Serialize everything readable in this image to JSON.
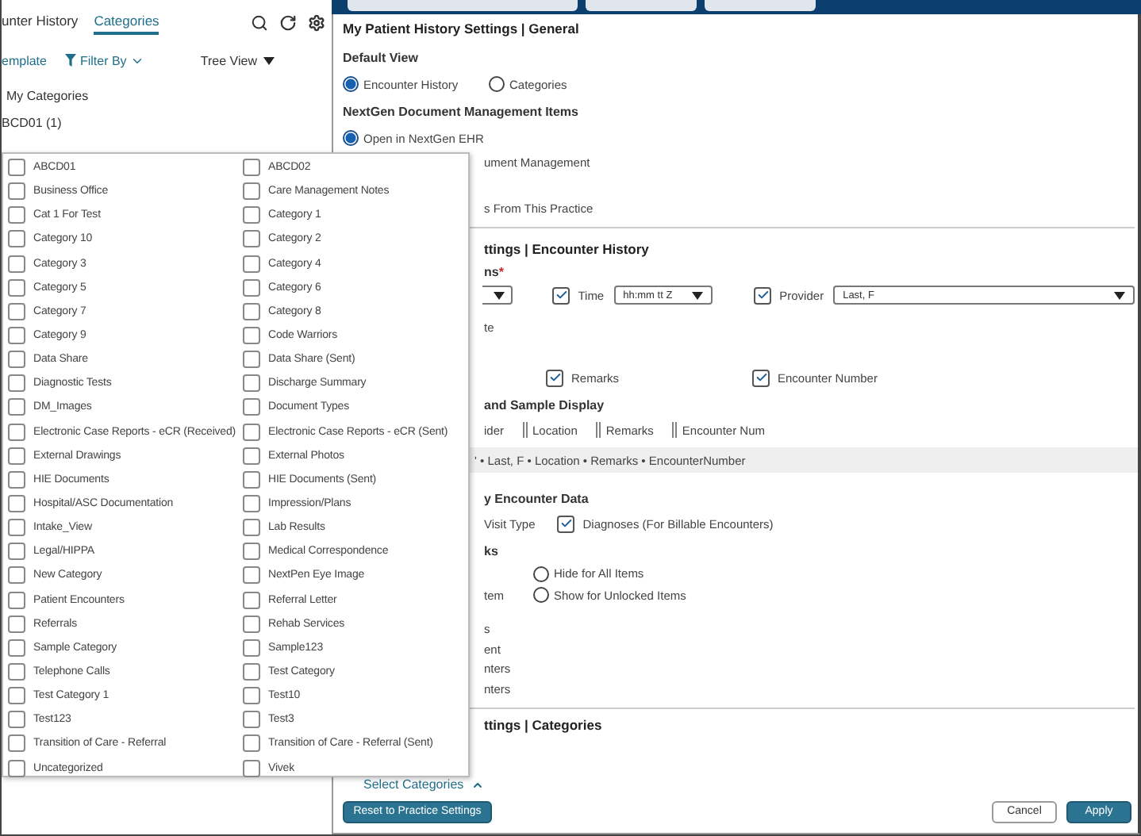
{
  "left_panel": {
    "tabs": [
      {
        "label": "unter History",
        "selected": false
      },
      {
        "label": "Categories",
        "selected": true
      }
    ],
    "toolbar": {
      "template_link": "emplate",
      "filter": "Filter By",
      "view": "Tree View"
    },
    "heading": "My Categories",
    "item": "BCD01 (1)"
  },
  "category_dropdown": {
    "items": [
      {
        "label": "ABCD01",
        "checked": false
      },
      {
        "label": "ABCD02",
        "checked": false
      },
      {
        "label": "Business Office",
        "checked": false
      },
      {
        "label": "Care Management Notes",
        "checked": false
      },
      {
        "label": "Cat 1 For Test",
        "checked": false
      },
      {
        "label": "Category 1",
        "checked": false
      },
      {
        "label": "Category 10",
        "checked": false
      },
      {
        "label": "Category 2",
        "checked": false
      },
      {
        "label": "Category 3",
        "checked": false
      },
      {
        "label": "Category 4",
        "checked": false
      },
      {
        "label": "Category 5",
        "checked": false
      },
      {
        "label": "Category 6",
        "checked": false
      },
      {
        "label": "Category 7",
        "checked": false
      },
      {
        "label": "Category 8",
        "checked": false
      },
      {
        "label": "Category 9",
        "checked": false
      },
      {
        "label": "Code Warriors",
        "checked": false
      },
      {
        "label": "Data Share",
        "checked": false
      },
      {
        "label": "Data Share (Sent)",
        "checked": false
      },
      {
        "label": "Diagnostic Tests",
        "checked": false
      },
      {
        "label": "Discharge Summary",
        "checked": false
      },
      {
        "label": "DM_Images",
        "checked": false
      },
      {
        "label": "Document Types",
        "checked": false
      },
      {
        "label": "Electronic Case Reports - eCR (Received)",
        "checked": false
      },
      {
        "label": "Electronic Case Reports - eCR (Sent)",
        "checked": false
      },
      {
        "label": "External Drawings",
        "checked": false
      },
      {
        "label": "External Photos",
        "checked": false
      },
      {
        "label": "HIE Documents",
        "checked": false
      },
      {
        "label": "HIE Documents (Sent)",
        "checked": false
      },
      {
        "label": "Hospital/ASC Documentation",
        "checked": false
      },
      {
        "label": "Impression/Plans",
        "checked": false
      },
      {
        "label": "Intake_View",
        "checked": false
      },
      {
        "label": "Lab Results",
        "checked": false
      },
      {
        "label": "Legal/HIPPA",
        "checked": false
      },
      {
        "label": "Medical Correspondence",
        "checked": false
      },
      {
        "label": "New Category",
        "checked": false
      },
      {
        "label": "NextPen Eye Image",
        "checked": false
      },
      {
        "label": "Patient Encounters",
        "checked": false
      },
      {
        "label": "Referral Letter",
        "checked": false
      },
      {
        "label": "Referrals",
        "checked": false
      },
      {
        "label": "Rehab Services",
        "checked": false
      },
      {
        "label": "Sample Category",
        "checked": false
      },
      {
        "label": "Sample123",
        "checked": false
      },
      {
        "label": "Telephone Calls",
        "checked": false
      },
      {
        "label": "Test Category",
        "checked": false
      },
      {
        "label": "Test Category 1",
        "checked": false
      },
      {
        "label": "Test10",
        "checked": false
      },
      {
        "label": "Test123",
        "checked": false
      },
      {
        "label": "Test3",
        "checked": false
      },
      {
        "label": "Transition of Care - Referral",
        "checked": false
      },
      {
        "label": "Transition of Care - Referral (Sent)",
        "checked": false
      },
      {
        "label": "Uncategorized",
        "checked": false
      },
      {
        "label": "Vivek",
        "checked": false
      }
    ]
  },
  "general": {
    "title": "My Patient History Settings | General",
    "default_view": {
      "label": "Default View",
      "options": [
        {
          "label": "Encounter History",
          "selected": true
        },
        {
          "label": "Categories",
          "selected": false
        }
      ]
    },
    "dm_items": {
      "label": "NextGen Document Management Items",
      "options": [
        {
          "label": "Open in NextGen EHR",
          "selected": true
        }
      ]
    },
    "fragments": [
      "ument Management",
      "s From This Practice"
    ]
  },
  "encounter_history": {
    "title": "ttings | Encounter History",
    "columns_label": "ns",
    "required_mark": "*",
    "time": {
      "label": "Time",
      "checked": true,
      "format": "hh:mm tt Z"
    },
    "provider": {
      "label": "Provider",
      "checked": true,
      "format": "Last, F"
    },
    "note": "te",
    "extra_columns": [
      {
        "label": "Remarks",
        "checked": true
      },
      {
        "label": "Encounter Number",
        "checked": true
      }
    ],
    "order_title": "and Sample Display",
    "order_items": [
      {
        "kind": "text",
        "label": "ider"
      },
      {
        "kind": "grip",
        "label": "Location"
      },
      {
        "kind": "grip",
        "label": "Remarks"
      },
      {
        "kind": "grip",
        "label": "Encounter Num"
      }
    ],
    "sample": "' • Last, F • Location • Remarks • EncounterNumber",
    "data_title": "y Encounter Data",
    "data_options": [
      {
        "kind": "text",
        "label": "Visit Type"
      },
      {
        "kind": "checkbox",
        "label": "Diagnoses (For Billable Encounters)",
        "checked": true
      }
    ],
    "links_title": "ks",
    "lock_options": [
      {
        "label": "Hide for All Items",
        "selected": false
      },
      {
        "side": "tem",
        "label": "Show for Unlocked Items",
        "selected": false
      }
    ],
    "fragments": [
      "s",
      "ent",
      "nters",
      "nters"
    ]
  },
  "categories": {
    "title": "ttings | Categories",
    "select_link": "Select Categories"
  },
  "buttons": {
    "reset": "Reset to Practice Settings",
    "cancel": "Cancel",
    "apply": "Apply"
  }
}
